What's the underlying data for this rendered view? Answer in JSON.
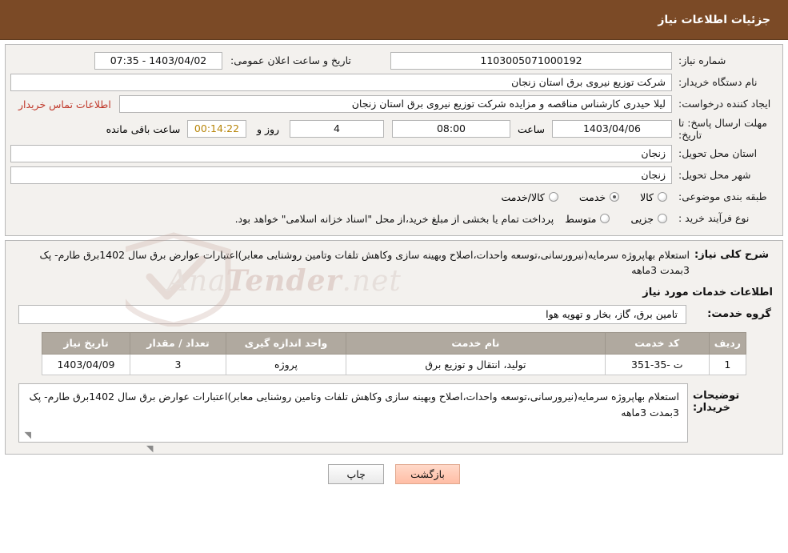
{
  "header": {
    "title": "جزئیات اطلاعات نیاز"
  },
  "form": {
    "need_number_label": "شماره نیاز:",
    "need_number_value": "1103005071000192",
    "announce_datetime_label": "تاریخ و ساعت اعلان عمومی:",
    "announce_datetime_value": "1403/04/02 - 07:35",
    "buyer_org_label": "نام دستگاه خریدار:",
    "buyer_org_value": "شرکت توزیع نیروی برق استان زنجان",
    "requester_label": "ایجاد کننده درخواست:",
    "requester_value": "لیلا حیدری کارشناس مناقصه و مزایده شرکت توزیع نیروی برق استان زنجان",
    "contact_link": "اطلاعات تماس خریدار",
    "deadline_label": "مهلت ارسال پاسخ: تا تاریخ:",
    "deadline_date": "1403/04/06",
    "deadline_hour_label": "ساعت",
    "deadline_hour": "08:00",
    "days_value": "4",
    "days_label": "روز و",
    "remaining_time": "00:14:22",
    "remaining_label": "ساعت باقی مانده",
    "province_label": "استان محل تحویل:",
    "province_value": "زنجان",
    "city_label": "شهر محل تحویل:",
    "city_value": "زنجان",
    "category_label": "طبقه بندی موضوعی:",
    "category_options": [
      "کالا",
      "خدمت",
      "کالا/خدمت"
    ],
    "category_selected": "خدمت",
    "purchase_type_label": "نوع فرآیند خرید :",
    "purchase_type_options": [
      "جزیی",
      "متوسط"
    ],
    "purchase_type_selected": "",
    "purchase_note": "پرداخت تمام یا بخشی از مبلغ خرید،از محل \"اسناد خزانه اسلامی\" خواهد بود."
  },
  "description": {
    "label": "شرح کلی نیاز:",
    "text": "استعلام بهاپروژه سرمایه(نیرورسانی،توسعه واحدات،اصلاح وبهینه سازی وکاهش تلفات وتامین روشنایی معابر)اعتبارات عوارض برق سال 1402برق طارم- پک 3بمدت 3ماهه"
  },
  "services": {
    "section_title": "اطلاعات خدمات مورد نیاز",
    "group_label": "گروه خدمت:",
    "group_value": "تامین برق، گاز، بخار و تهویه هوا",
    "columns": [
      "ردیف",
      "کد خدمت",
      "نام خدمت",
      "واحد اندازه گیری",
      "تعداد / مقدار",
      "تاریخ نیاز"
    ],
    "rows": [
      {
        "index": "1",
        "code": "ت -35-351",
        "name": "تولید، انتقال و توزیع برق",
        "unit": "پروژه",
        "qty": "3",
        "date": "1403/04/09"
      }
    ]
  },
  "buyer_notes": {
    "label": "توضیحات خریدار:",
    "text": "استعلام بهاپروژه سرمایه(نیرورسانی،توسعه واحدات،اصلاح وبهینه سازی وکاهش تلفات وتامین روشنایی معابر)اعتبارات عوارض برق سال 1402برق طارم- پک 3بمدت 3ماهه"
  },
  "footer": {
    "print": "چاپ",
    "back": "بازگشت"
  },
  "watermark": {
    "text_1": "Ana",
    "text_2": "Tender",
    "text_3": ".net"
  },
  "colors": {
    "header_bg": "#7b4a26",
    "panel_bg": "#f3f1ee",
    "link": "#c0392b",
    "table_header": "#b0a99f"
  }
}
